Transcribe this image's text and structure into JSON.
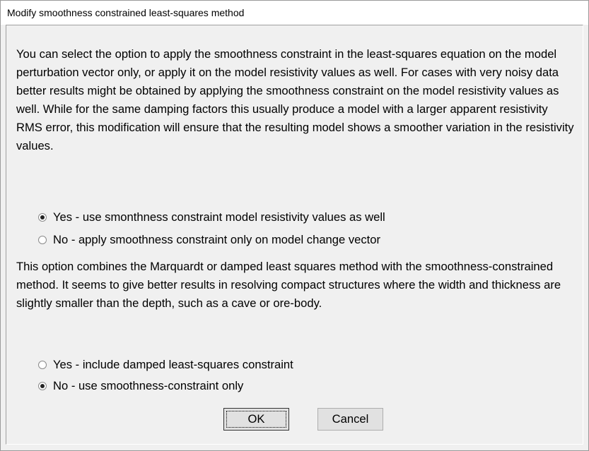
{
  "window": {
    "title": "Modify smoothness constrained least-squares method"
  },
  "main": {
    "paragraph1": "You can select the option to apply the smoothness constraint in the least-squares equation on the model perturbation vector only, or apply it on the model resistivity values as well. For cases with very noisy data better results might be obtained by applying the smoothness constraint on the model resistivity values as well. While for the same damping factors this usually produce a model with a larger apparent resistivity RMS error, this modification will ensure that the resulting model shows a smoother variation in the resistivity values.",
    "option_group1": [
      {
        "label": "Yes - use smonthness constraint model resistivity values as well",
        "selected": true
      },
      {
        "label": "No - apply smoothness constraint only on model change vector",
        "selected": false
      }
    ],
    "paragraph2": "This option combines the Marquardt or damped least squares method with the smoothness-constrained method. It seems to give better results in resolving compact structures where the width and thickness are slightly smaller than the depth, such as a cave or ore-body.",
    "option_group2": [
      {
        "label": "Yes - include damped least-squares constraint",
        "selected": false
      },
      {
        "label": "No - use smoothness-constraint only",
        "selected": true
      }
    ]
  },
  "buttons": {
    "ok_label": "OK",
    "cancel_label": "Cancel"
  }
}
